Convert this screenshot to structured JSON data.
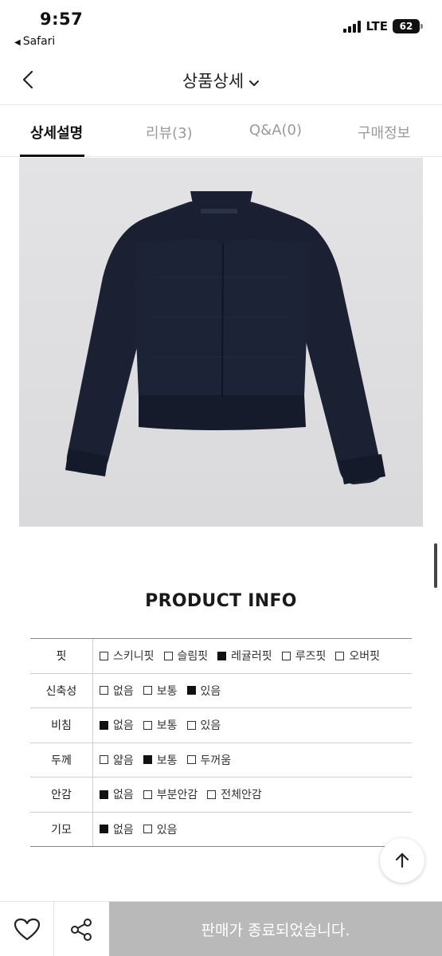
{
  "status_bar": {
    "time": "9:57",
    "back_app": "Safari",
    "network": "LTE",
    "battery": "62",
    "battery_level": 0.62
  },
  "header": {
    "title": "상품상세",
    "back_icon": "chevron-left-icon",
    "dropdown_icon": "chevron-down-icon"
  },
  "tabs": [
    {
      "label": "상세설명",
      "active": true
    },
    {
      "label": "리뷰(3)",
      "active": false
    },
    {
      "label": "Q&A(0)",
      "active": false
    },
    {
      "label": "구매정보",
      "active": false
    }
  ],
  "product_info": {
    "title": "PRODUCT INFO",
    "rows": [
      {
        "label": "핏",
        "options": [
          {
            "text": "스키니핏",
            "checked": false
          },
          {
            "text": "슬림핏",
            "checked": false
          },
          {
            "text": "레귤러핏",
            "checked": true
          },
          {
            "text": "루즈핏",
            "checked": false
          },
          {
            "text": "오버핏",
            "checked": false
          }
        ]
      },
      {
        "label": "신축성",
        "options": [
          {
            "text": "없음",
            "checked": false
          },
          {
            "text": "보통",
            "checked": false
          },
          {
            "text": "있음",
            "checked": true
          }
        ]
      },
      {
        "label": "비침",
        "options": [
          {
            "text": "없음",
            "checked": true
          },
          {
            "text": "보통",
            "checked": false
          },
          {
            "text": "있음",
            "checked": false
          }
        ]
      },
      {
        "label": "두께",
        "options": [
          {
            "text": "얇음",
            "checked": false
          },
          {
            "text": "보통",
            "checked": true
          },
          {
            "text": "두꺼움",
            "checked": false
          }
        ]
      },
      {
        "label": "안감",
        "options": [
          {
            "text": "없음",
            "checked": true
          },
          {
            "text": "부분안감",
            "checked": false
          },
          {
            "text": "전체안감",
            "checked": false
          }
        ]
      },
      {
        "label": "기모",
        "options": [
          {
            "text": "없음",
            "checked": true
          },
          {
            "text": "있음",
            "checked": false
          }
        ]
      }
    ]
  },
  "bottom_bar": {
    "like_icon": "heart-icon",
    "share_icon": "share-icon",
    "sold_out_text": "판매가 종료되었습니다."
  },
  "floating": {
    "scroll_top_icon": "arrow-up-icon"
  },
  "colors": {
    "garment": "#1c2235",
    "sold_out_bg": "#b9b9b9",
    "image_bg": "#dfdfe1"
  }
}
